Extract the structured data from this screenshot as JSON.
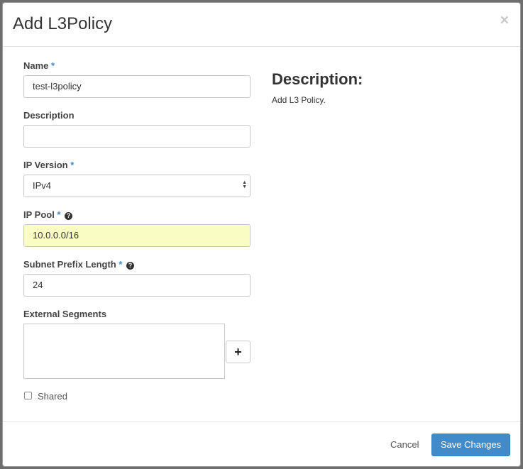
{
  "modal": {
    "title": "Add L3Policy",
    "close_glyph": "×"
  },
  "form": {
    "name": {
      "label": "Name",
      "required_mark": "*",
      "value": "test-l3policy"
    },
    "description": {
      "label": "Description",
      "value": ""
    },
    "ip_version": {
      "label": "IP Version",
      "required_mark": "*",
      "selected": "IPv4",
      "arrows_icon": "select-arrows-icon"
    },
    "ip_pool": {
      "label": "IP Pool",
      "required_mark": "*",
      "help_icon": "?",
      "value": "10.0.0.0/16"
    },
    "subnet_prefix_length": {
      "label": "Subnet Prefix Length",
      "required_mark": "*",
      "help_icon": "?",
      "value": "24"
    },
    "external_segments": {
      "label": "External Segments",
      "add_glyph": "+"
    },
    "shared": {
      "label": "Shared",
      "checked": false
    }
  },
  "help_panel": {
    "heading": "Description:",
    "text": "Add L3 Policy."
  },
  "footer": {
    "cancel_label": "Cancel",
    "save_label": "Save Changes"
  },
  "colors": {
    "primary": "#428bca",
    "highlight_input": "#fafdc3",
    "required": "#428bca"
  }
}
